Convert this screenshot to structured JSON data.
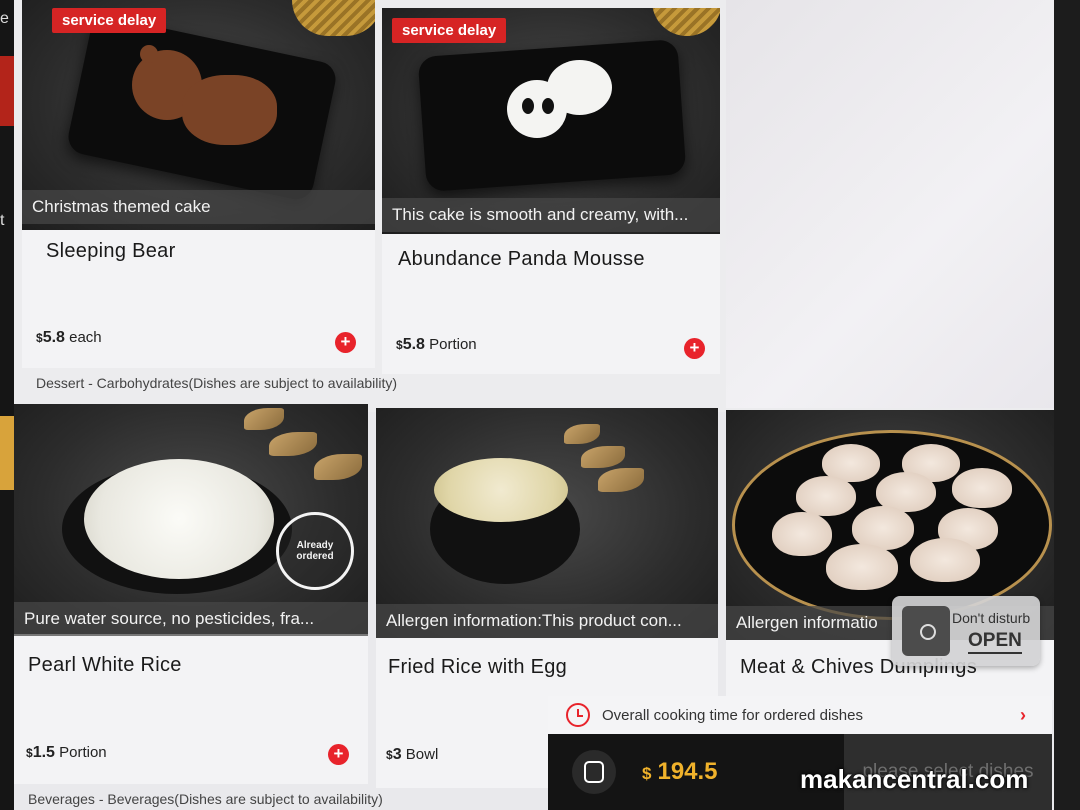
{
  "sidebar": {
    "chars": [
      "e",
      "t"
    ]
  },
  "dishes_top": [
    {
      "badge": "service delay",
      "caption": "Christmas themed cake",
      "name": "Sleeping Bear",
      "price_currency": "$",
      "price_value": "5.8",
      "unit": "each"
    },
    {
      "badge": "service delay",
      "caption": "This cake is smooth and creamy, with...",
      "name": "Abundance Panda Mousse",
      "price_currency": "$",
      "price_value": "5.8",
      "unit": "Portion"
    }
  ],
  "section_dessert": "Dessert - Carbohydrates(Dishes are subject to availability)",
  "dishes_bottom": [
    {
      "caption": "Pure water source, no pesticides, fra...",
      "name": "Pearl White Rice",
      "price_currency": "$",
      "price_value": "1.5",
      "unit": "Portion",
      "stamp": "Already ordered"
    },
    {
      "caption": "Allergen information:This product con...",
      "name": "Fried Rice with Egg",
      "price_currency": "$",
      "price_value": "3",
      "unit": "Bowl"
    },
    {
      "caption": "Allergen informatio",
      "name": "Meat & Chives Dumplings"
    }
  ],
  "section_beverages": "Beverages - Beverages(Dishes are subject to availability)",
  "cooking_bar": {
    "label": "Overall cooking time for ordered dishes"
  },
  "cart": {
    "currency": "$",
    "total": "194.5",
    "select_label": "please select dishes"
  },
  "dnd": {
    "line1": "Don't disturb",
    "line2": "OPEN"
  },
  "watermark": "makancentral.com",
  "colors": {
    "accent": "#e8232b",
    "total": "#f0b22b",
    "badge": "#d62424"
  }
}
